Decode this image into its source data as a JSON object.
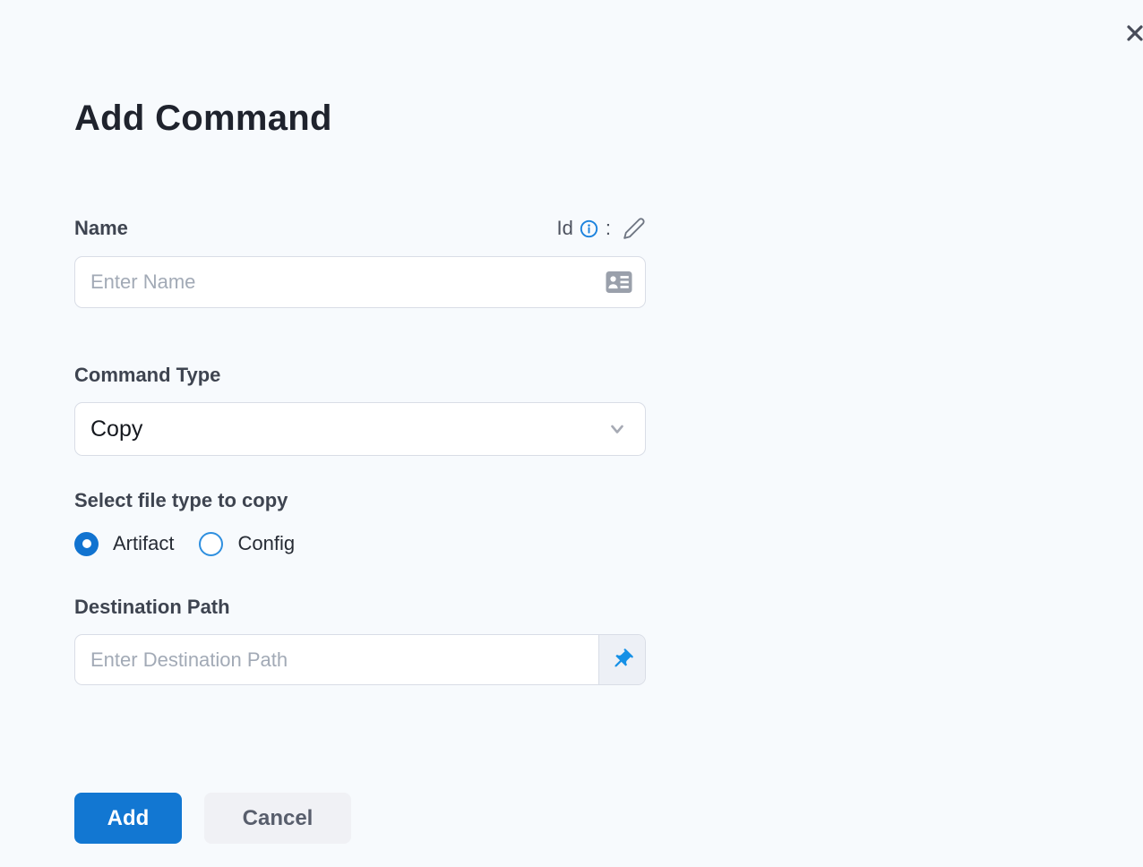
{
  "panel": {
    "title": "Add Command"
  },
  "name_field": {
    "label": "Name",
    "id_label": "Id",
    "id_separator": ":",
    "placeholder": "Enter Name",
    "value": ""
  },
  "command_type": {
    "label": "Command Type",
    "selected": "Copy"
  },
  "file_type": {
    "label": "Select file type to copy",
    "options": [
      {
        "label": "Artifact",
        "selected": true
      },
      {
        "label": "Config",
        "selected": false
      }
    ]
  },
  "destination": {
    "label": "Destination Path",
    "placeholder": "Enter Destination Path",
    "value": ""
  },
  "actions": {
    "add": "Add",
    "cancel": "Cancel"
  },
  "icons": {
    "close": "x-icon",
    "info": "info-icon",
    "edit": "pencil-icon",
    "name_suffix": "contact-card-icon",
    "select": "chevron-down-icon",
    "destination_suffix": "pushpin-icon"
  },
  "colors": {
    "background": "#f7fafd",
    "primary_blue": "#1277d2",
    "pin_blue": "#1590e6",
    "radio_blue": "#1173d0",
    "info_blue": "#1b82dd",
    "border": "#d9dde6",
    "title_text": "#1f232d",
    "label_text": "#3e4450",
    "placeholder_text": "#a2aab6",
    "cancel_bg": "#f0f1f5",
    "cancel_text": "#585e6c"
  }
}
